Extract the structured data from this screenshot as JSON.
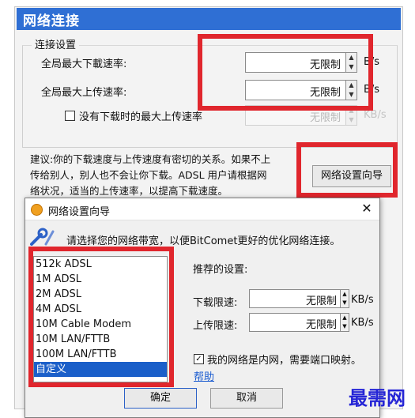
{
  "settings_page": {
    "title": "网络连接",
    "group_legend": "连接设置",
    "max_download_label": "全局最大下載速率:",
    "max_download_value": "无限制",
    "max_upload_label": "全局最大上传速率:",
    "max_upload_value": "无限制",
    "unit": "KB/s",
    "unit_short": "B/s",
    "no_download_upload_label": "没有下载时的最大上传速率",
    "no_download_upload_value": "无限制",
    "hint_line1": "建议:你的下载速度与上传速度有密切的关系。如果不上",
    "hint_line2": "传给别人，别人也不会让你下载。ADSL 用户请根据网",
    "hint_line3": "络状况，适当的上传速率，以提高下载速度。",
    "wizard_button": "网络设置向导"
  },
  "wizard": {
    "title": "网络设置向导",
    "close_glyph": "✕",
    "prompt": "请选择您的网络带宽，以便BitComet更好的优化网络连接。",
    "bandwidth_options": [
      "512k ADSL",
      "1M ADSL",
      "2M ADSL",
      "4M ADSL",
      "10M Cable Modem",
      "10M LAN/FTTB",
      "100M LAN/FTTB",
      "自定义"
    ],
    "selected_option": "自定义",
    "recommended_label": "推荐的设置:",
    "download_limit_label": "下载限速:",
    "download_limit_value": "无限制",
    "upload_limit_label": "上传限速:",
    "upload_limit_value": "无限制",
    "unit": "KB/s",
    "lan_checkbox_label": "我的网络是内网，需要端口映射。",
    "lan_checked": true,
    "help_link": "帮助",
    "ok_button": "确定",
    "cancel_button": "取消"
  },
  "watermark": "最需网",
  "colors": {
    "title_bar": "#2f6fd4",
    "highlight_red": "#e0262d",
    "selection_blue": "#1b5fc9",
    "link_blue": "#1a5bd0"
  }
}
